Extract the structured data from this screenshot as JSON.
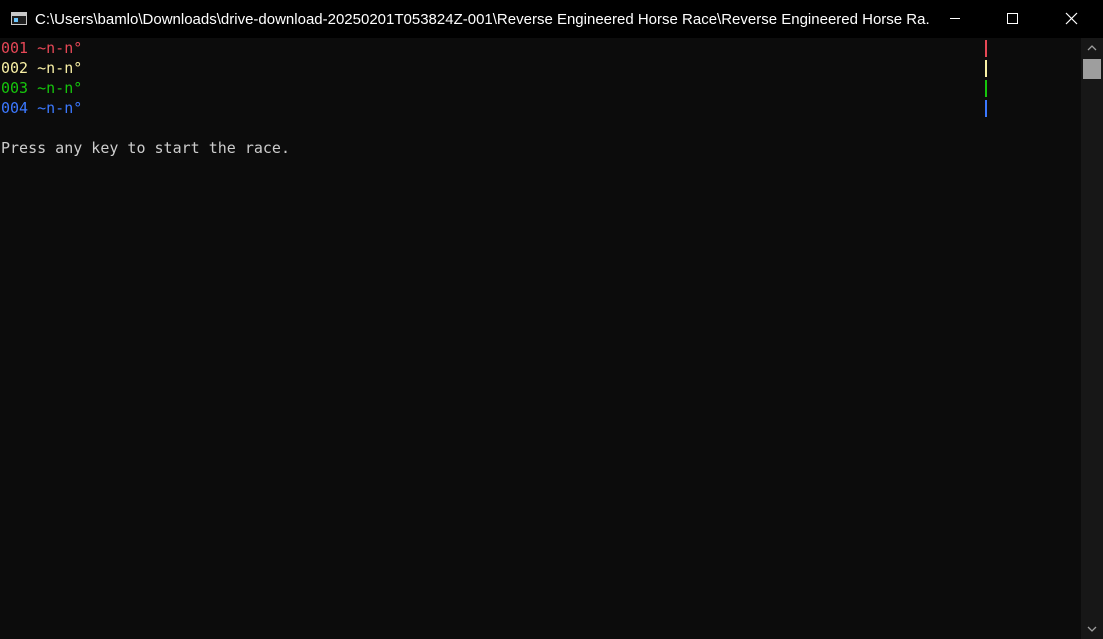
{
  "window": {
    "title": "C:\\Users\\bamlo\\Downloads\\drive-download-20250201T053824Z-001\\Reverse Engineered Horse Race\\Reverse Engineered Horse Ra..."
  },
  "controls": {
    "minimize_icon": "minimize-icon",
    "maximize_icon": "maximize-icon",
    "close_icon": "close-icon"
  },
  "race": {
    "lanes": [
      {
        "number": "001",
        "horse": "~n-n°",
        "color": "#e74856"
      },
      {
        "number": "002",
        "horse": "~n-n°",
        "color": "#f9f1a5"
      },
      {
        "number": "003",
        "horse": "~n-n°",
        "color": "#16c60c"
      },
      {
        "number": "004",
        "horse": "~n-n°",
        "color": "#3b78ff"
      }
    ],
    "prompt": "Press any key to start the race."
  },
  "colors": {
    "background": "#0c0c0c",
    "text": "#cccccc",
    "titlebar": "#000000"
  }
}
